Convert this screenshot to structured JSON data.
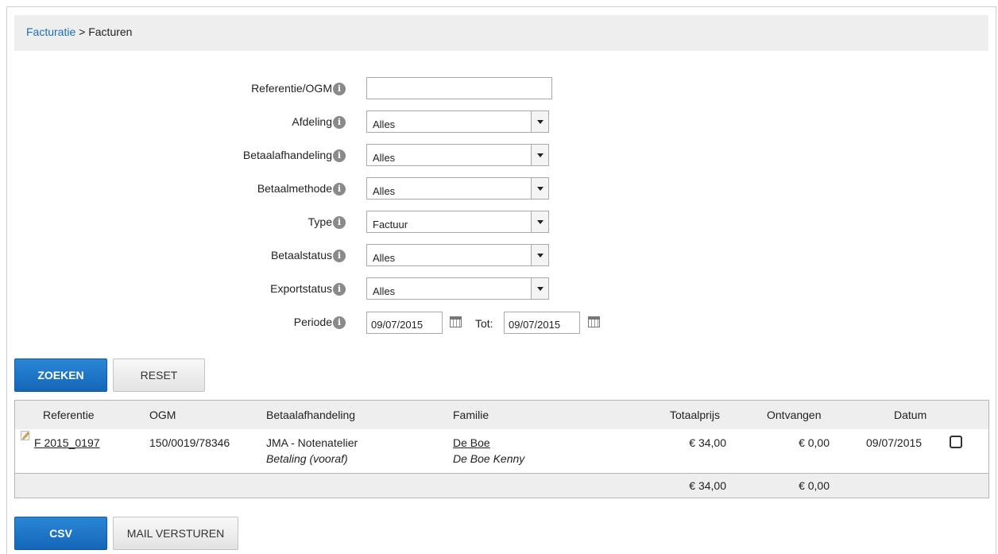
{
  "breadcrumb": {
    "parent": "Facturatie",
    "separator": " > ",
    "current": "Facturen"
  },
  "filters": {
    "referentie": {
      "label": "Referentie/OGM",
      "value": ""
    },
    "afdeling": {
      "label": "Afdeling",
      "value": "Alles"
    },
    "betaalafhandeling": {
      "label": "Betaalafhandeling",
      "value": "Alles"
    },
    "betaalmethode": {
      "label": "Betaalmethode",
      "value": "Alles"
    },
    "type": {
      "label": "Type",
      "value": "Factuur"
    },
    "betaalstatus": {
      "label": "Betaalstatus",
      "value": "Alles"
    },
    "exportstatus": {
      "label": "Exportstatus",
      "value": "Alles"
    },
    "periode": {
      "label": "Periode",
      "from": "09/07/2015",
      "to_label": "Tot:",
      "to": "09/07/2015"
    },
    "info_glyph": "i"
  },
  "actions": {
    "search": "ZOEKEN",
    "reset": "RESET",
    "csv": "CSV",
    "mail": "MAIL VERSTUREN"
  },
  "table": {
    "headers": {
      "referentie": "Referentie",
      "ogm": "OGM",
      "betaalafhandeling": "Betaalafhandeling",
      "familie": "Familie",
      "totaalprijs": "Totaalprijs",
      "ontvangen": "Ontvangen",
      "datum": "Datum"
    },
    "rows": [
      {
        "referentie": "F 2015_0197",
        "ogm": "150/0019/78346",
        "betaalafhandeling": "JMA - Notenatelier",
        "betaalafhandeling_sub": "Betaling (vooraf)",
        "familie": "De Boe",
        "familie_sub": "De Boe Kenny",
        "totaalprijs": "€ 34,00",
        "ontvangen": "€ 0,00",
        "datum": "09/07/2015"
      }
    ],
    "totals": {
      "totaalprijs": "€ 34,00",
      "ontvangen": "€ 0,00"
    }
  }
}
